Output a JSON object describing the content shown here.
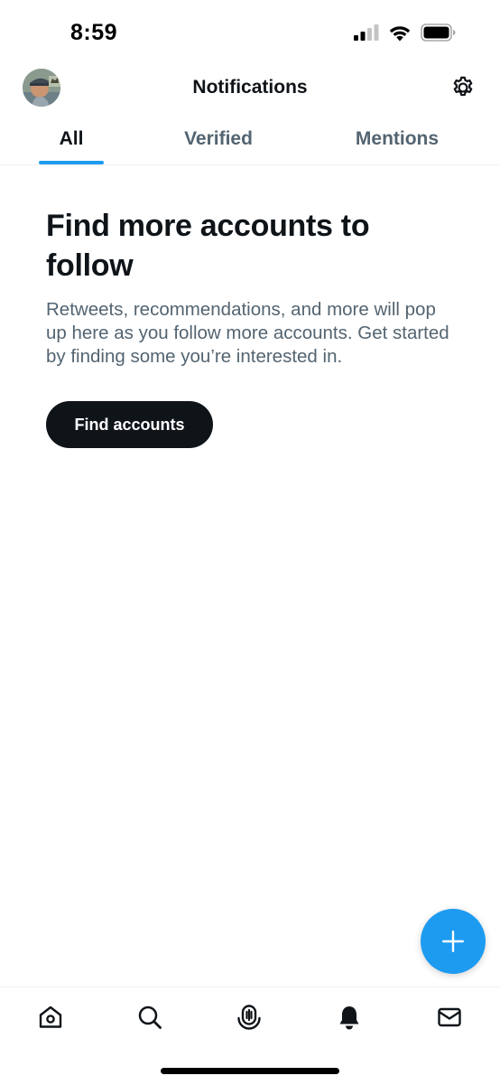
{
  "status_bar": {
    "time": "8:59"
  },
  "header": {
    "title": "Notifications",
    "avatar_icon": "user-avatar",
    "settings_icon": "gear-icon"
  },
  "tabs": [
    {
      "label": "All",
      "active": true
    },
    {
      "label": "Verified",
      "active": false
    },
    {
      "label": "Mentions",
      "active": false
    }
  ],
  "empty_state": {
    "title": "Find more accounts to follow",
    "body": "Retweets, recommendations, and more will pop up here as you follow more accounts. Get started by finding some you’re interested in.",
    "button_label": "Find accounts"
  },
  "fab": {
    "icon": "plus-icon"
  },
  "bottom_nav": [
    {
      "icon": "home-icon",
      "active": false
    },
    {
      "icon": "search-icon",
      "active": false
    },
    {
      "icon": "spaces-icon",
      "active": false
    },
    {
      "icon": "bell-icon",
      "active": true
    },
    {
      "icon": "mail-icon",
      "active": false
    }
  ],
  "colors": {
    "accent": "#1d9bf0",
    "text_primary": "#0f1419",
    "text_secondary": "#536471",
    "divider": "#eff3f4"
  }
}
